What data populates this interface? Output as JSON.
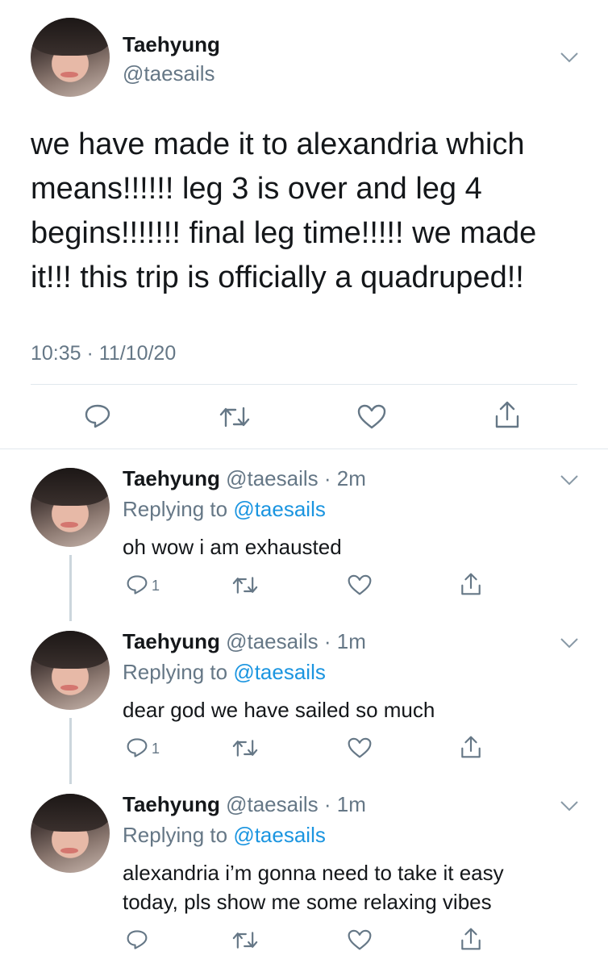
{
  "main_tweet": {
    "name": "Taehyung",
    "handle": "@taesails",
    "text_lines": [
      "we have made it to alexandria which",
      "means!!!!!! leg 3 is over and leg 4",
      "begins!!!!!!! final leg time!!!!! we made",
      "it!!! this trip is officially a quadruped!!"
    ],
    "timestamp": "10:35 · 11/10/20"
  },
  "replies": [
    {
      "name": "Taehyung",
      "meta": "@taesails · 2m",
      "replying_prefix": "Replying to ",
      "replying_to": "@taesails",
      "text_lines": [
        "oh wow i am exhausted"
      ],
      "reply_count": "1"
    },
    {
      "name": "Taehyung",
      "meta": "@taesails · 1m",
      "replying_prefix": "Replying to ",
      "replying_to": "@taesails",
      "text_lines": [
        "dear god we have sailed so much"
      ],
      "reply_count": "1"
    },
    {
      "name": "Taehyung",
      "meta": "@taesails · 1m",
      "replying_prefix": "Replying to ",
      "replying_to": "@taesails",
      "text_lines": [
        "alexandria i’m gonna need to take it easy",
        "today, pls show me some relaxing vibes"
      ],
      "reply_count": ""
    }
  ],
  "icons": {
    "reply": "reply-icon",
    "retweet": "retweet-icon",
    "like": "heart-icon",
    "share": "share-icon",
    "more": "chevron-down-icon"
  },
  "colors": {
    "link": "#1b95e0",
    "secondary_text": "#657786",
    "divider": "#e1e8ed",
    "thread_line": "#ccd6dd"
  }
}
